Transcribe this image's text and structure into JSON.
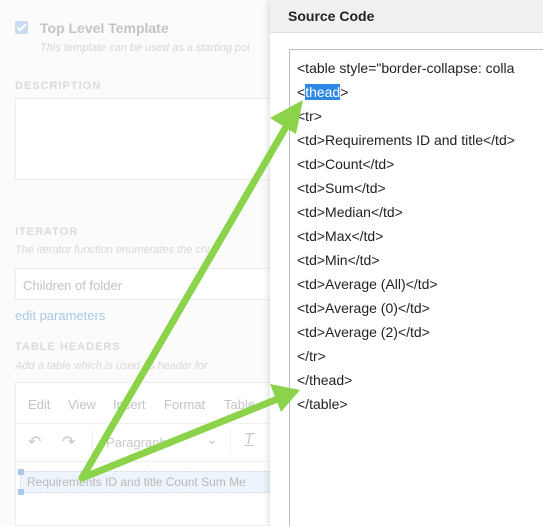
{
  "background_form": {
    "template_checkbox_label": "Top Level Template",
    "template_hint": "This template can be used as a starting poi",
    "description_label": "DESCRIPTION",
    "iterator_label": "ITERATOR",
    "iterator_hint": "The iterator function enumerates the chi",
    "iterator_value": "Children of folder",
    "edit_parameters_link": "edit parameters",
    "table_headers_label": "TABLE HEADERS",
    "table_headers_hint": "Add a table which is used as header for",
    "editor": {
      "menu": [
        "Edit",
        "View",
        "Insert",
        "Format",
        "Table"
      ],
      "block_format": "Paragraph",
      "table_row_text": "Requirements ID and title Count Sum Me"
    }
  },
  "dialog": {
    "title": "Source Code",
    "code": {
      "line_0": "<table style=\"border-collapse: colla",
      "line_1_prefix": "<",
      "line_1_selected": "thead",
      "line_1_suffix": ">",
      "line_2": "<tr>",
      "line_3": "<td>Requirements ID and title</td>",
      "line_4": "<td>Count</td>",
      "line_5": "<td>Sum</td>",
      "line_6": "<td>Median</td>",
      "line_7": "<td>Max</td>",
      "line_8": "<td>Min</td>",
      "line_9": "<td>Average (All)</td>",
      "line_10": "<td>Average (0)</td>",
      "line_11": "<td>Average (2)</td>",
      "line_12": "</tr>",
      "line_13": "</thead>",
      "line_14": "</table>"
    }
  },
  "colors": {
    "selection": "#2f88e6",
    "annotation_arrow": "#8bd34a"
  }
}
